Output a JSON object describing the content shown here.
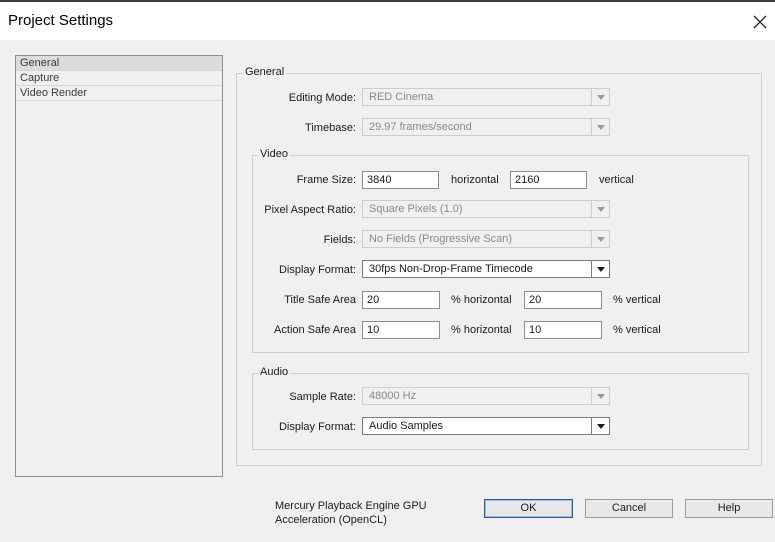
{
  "window": {
    "title": "Project Settings"
  },
  "sidebar": {
    "items": [
      {
        "label": "General",
        "selected": true
      },
      {
        "label": "Capture"
      },
      {
        "label": "Video Render"
      }
    ]
  },
  "general": {
    "section_title": "General",
    "editing_mode": {
      "label": "Editing Mode:",
      "value": "RED Cinema"
    },
    "timebase": {
      "label": "Timebase:",
      "value": "29.97 frames/second"
    }
  },
  "video": {
    "section_title": "Video",
    "frame_size": {
      "label": "Frame Size:",
      "width": "3840",
      "horizontal_label": "horizontal",
      "height": "2160",
      "vertical_label": "vertical"
    },
    "pixel_aspect_ratio": {
      "label": "Pixel Aspect Ratio:",
      "value": "Square Pixels (1.0)"
    },
    "fields": {
      "label": "Fields:",
      "value": "No Fields (Progressive Scan)"
    },
    "display_format": {
      "label": "Display Format:",
      "value": "30fps Non-Drop-Frame Timecode"
    },
    "title_safe": {
      "label": "Title Safe Area",
      "horizontal": "20",
      "horizontal_label": "% horizontal",
      "vertical": "20",
      "vertical_label": "% vertical"
    },
    "action_safe": {
      "label": "Action Safe Area",
      "horizontal": "10",
      "horizontal_label": "% horizontal",
      "vertical": "10",
      "vertical_label": "% vertical"
    }
  },
  "audio": {
    "section_title": "Audio",
    "sample_rate": {
      "label": "Sample Rate:",
      "value": "48000 Hz"
    },
    "display_format": {
      "label": "Display Format:",
      "value": "Audio Samples"
    }
  },
  "footer": {
    "note": "Mercury Playback Engine GPU Acceleration (OpenCL)",
    "ok_label": "OK",
    "cancel_label": "Cancel",
    "help_label": "Help"
  },
  "colors": {
    "default_button_border": "#2c5a9b",
    "background": "#f0f0f0"
  }
}
